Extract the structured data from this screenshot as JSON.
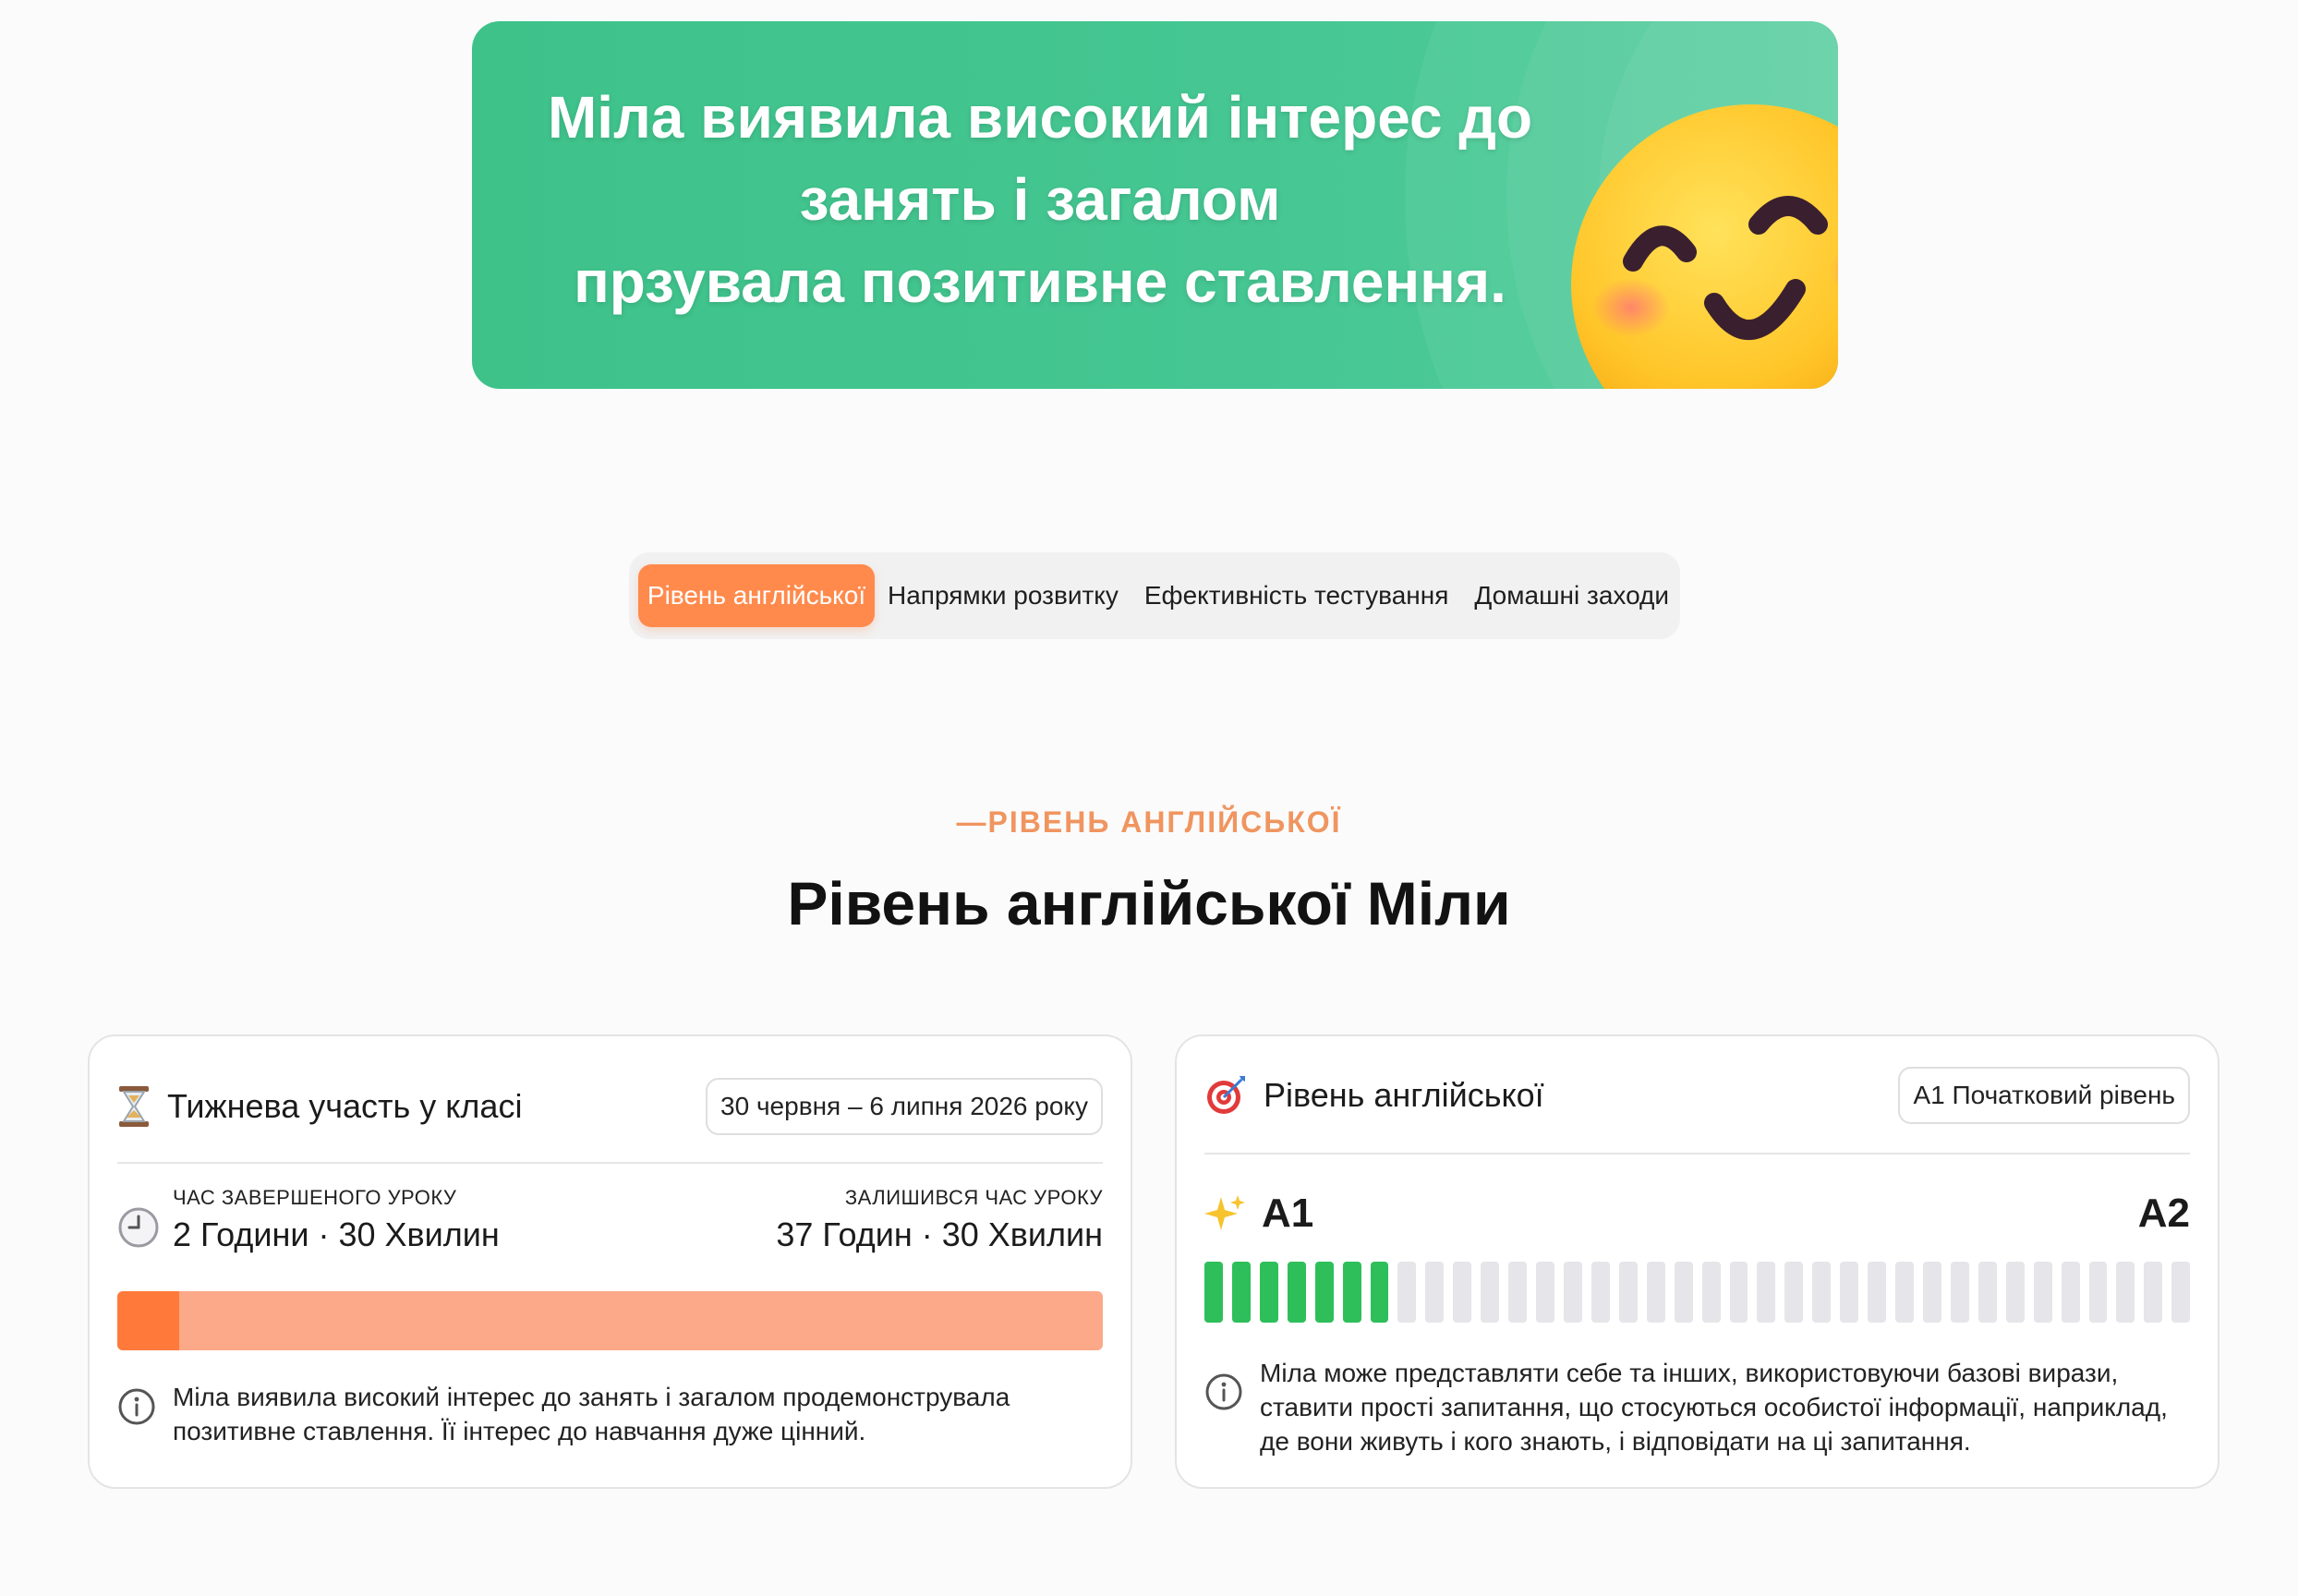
{
  "banner": {
    "lines": [
      "Міла виявила високий інтерес до",
      "занять і загалом",
      "прзувала позитивне ставлення."
    ]
  },
  "tabs": [
    {
      "label": "Рівень англійської",
      "active": true
    },
    {
      "label": "Напрямки розвитку",
      "active": false
    },
    {
      "label": "Ефективність тестування",
      "active": false
    },
    {
      "label": "Домашні заходи",
      "active": false
    }
  ],
  "section": {
    "eyebrow": "—РІВЕНЬ АНГЛІЙСЬКОЇ",
    "title": "Рівень англійської Міли"
  },
  "participation": {
    "title": "Тижнева участь у класі",
    "date_range": "30 червня – 6 липня 2026 року",
    "completed_label": "ЧАС ЗАВЕРШЕНОГО УРОКУ",
    "completed_value": "2 Години · 30 Хвилин",
    "remaining_label": "ЗАЛИШИВСЯ ЧАС УРОКУ",
    "remaining_value": "37 Годин · 30 Хвилин",
    "progress_fraction": 0.0625,
    "note": "Міла виявила високий інтерес до занять і загалом продемонструвала позитивне ставлення. Її інтерес до навчання дуже цінний."
  },
  "english_level": {
    "title": "Рівень англійської",
    "badge": "A1 Початковий рівень",
    "current_level": "A1",
    "next_level": "A2",
    "segments_total": 36,
    "segments_filled": 7,
    "note": "Міла може представляти себе та інших, використовуючи базові вирази, ставити прості запитання, що стосуються особистої інформації, наприклад, де вони живуть і кого знають, і відповідати на ці запитання."
  },
  "colors": {
    "banner_green": "#45c692",
    "accent_orange": "#ff8a4c",
    "progress_track": "#fba988",
    "progress_fill": "#ff7a3a",
    "segment_on": "#2ebf5a",
    "segment_off": "#e5e5ea"
  },
  "icons": {
    "participation": "hourglass-icon",
    "time": "clock-icon",
    "level": "target-icon",
    "level_marker": "sparkles-icon",
    "info": "info-icon"
  }
}
